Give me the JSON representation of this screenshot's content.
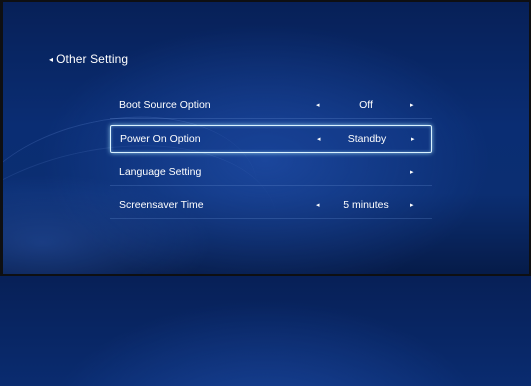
{
  "page": {
    "title": "Other Setting"
  },
  "menu": {
    "items": [
      {
        "label": "Boot Source Option",
        "value": "Off",
        "left_arrow": "◂",
        "right_arrow": "▸",
        "selected": false
      },
      {
        "label": "Power On Option",
        "value": "Standby",
        "left_arrow": "◂",
        "right_arrow": "▸",
        "selected": true
      },
      {
        "label": "Language Setting",
        "value": "",
        "left_arrow": "",
        "right_arrow": "▸",
        "selected": false
      },
      {
        "label": "Screensaver Time",
        "value": "5 minutes",
        "left_arrow": "◂",
        "right_arrow": "▸",
        "selected": false
      }
    ]
  },
  "colors": {
    "background": "#0a2d73",
    "highlight_border": "#d9f2ff",
    "text": "#ffffff"
  }
}
